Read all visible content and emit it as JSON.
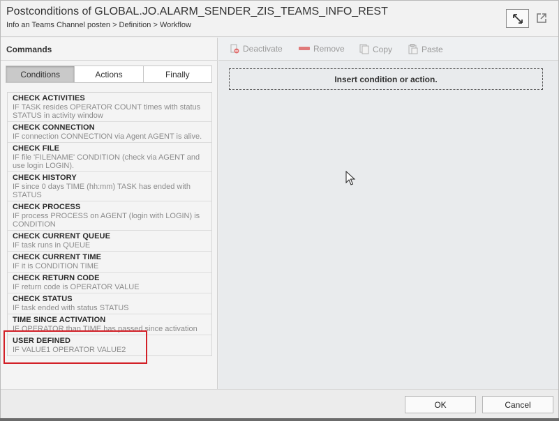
{
  "dialog": {
    "title": "Postconditions of GLOBAL.JO.ALARM_SENDER_ZIS_TEAMS_INFO_REST",
    "breadcrumb": "Info an Teams Channel posten > Definition > Workflow",
    "maximize_icon": "maximize-icon",
    "popout_icon": "popout-icon"
  },
  "commands": {
    "title": "Commands",
    "tabs": [
      {
        "label": "Conditions",
        "active": true
      },
      {
        "label": "Actions",
        "active": false
      },
      {
        "label": "Finally",
        "active": false
      }
    ],
    "items": [
      {
        "name": "CHECK ACTIVITIES",
        "desc": "IF TASK resides OPERATOR COUNT times with status STATUS in activity window"
      },
      {
        "name": "CHECK CONNECTION",
        "desc": "IF connection CONNECTION via Agent AGENT is alive."
      },
      {
        "name": "CHECK FILE",
        "desc": "IF file 'FILENAME' CONDITION (check via AGENT and use login LOGIN)."
      },
      {
        "name": "CHECK HISTORY",
        "desc": "IF since 0 days TIME (hh:mm) TASK has ended with STATUS"
      },
      {
        "name": "CHECK PROCESS",
        "desc": "IF process PROCESS on AGENT (login with LOGIN) is CONDITION"
      },
      {
        "name": "CHECK CURRENT QUEUE",
        "desc": "IF task runs in QUEUE"
      },
      {
        "name": "CHECK CURRENT TIME",
        "desc": "IF it is CONDITION TIME"
      },
      {
        "name": "CHECK RETURN CODE",
        "desc": "IF return code is OPERATOR VALUE"
      },
      {
        "name": "CHECK STATUS",
        "desc": "IF task ended with status STATUS"
      },
      {
        "name": "TIME SINCE ACTIVATION",
        "desc": "IF OPERATOR than TIME has passed since activation"
      },
      {
        "name": "USER DEFINED",
        "desc": "IF VALUE1 OPERATOR VALUE2"
      }
    ]
  },
  "toolbar": {
    "deactivate": "Deactivate",
    "remove": "Remove",
    "copy": "Copy",
    "paste": "Paste"
  },
  "workspace": {
    "placeholder": "Insert condition or action."
  },
  "footer": {
    "ok": "OK",
    "cancel": "Cancel"
  },
  "colors": {
    "highlight": "#d21f26",
    "active_tab": "#c9c9c9",
    "disabled_text": "#9a9a9a"
  }
}
